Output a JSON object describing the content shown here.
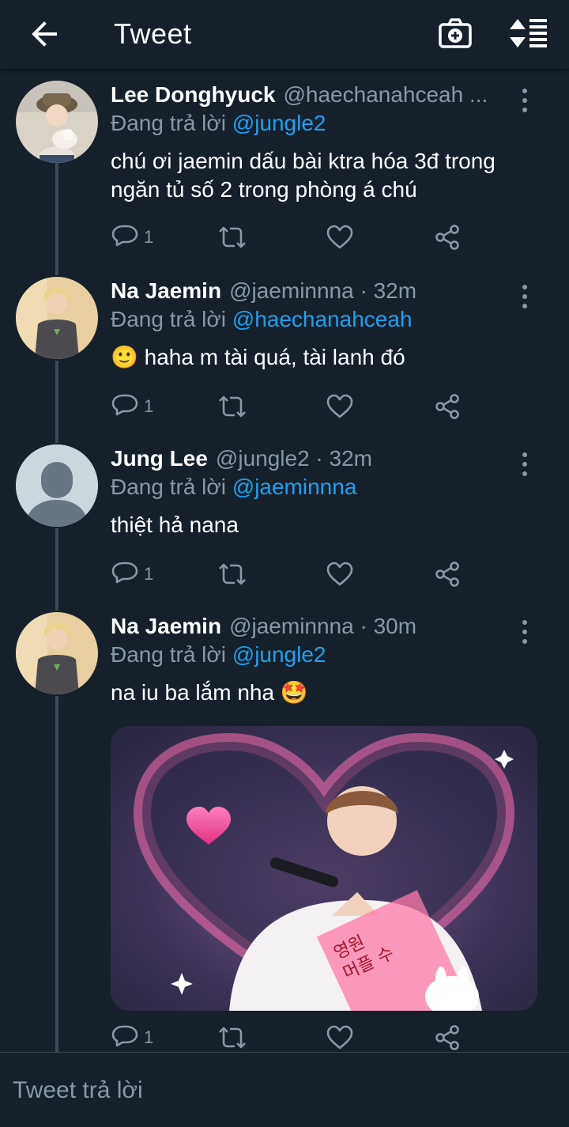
{
  "header": {
    "title": "Tweet",
    "back_icon": "arrow-left-icon",
    "camera_icon": "camera-add-icon",
    "sort_icon": "sort-icon"
  },
  "colors": {
    "background": "#15202b",
    "accent": "#1da1f2",
    "muted": "#8899a6",
    "thread_line": "#3d4b59"
  },
  "tweets": [
    {
      "display_name": "Lee Donghyuck",
      "handle": "@haechanahceah ...",
      "reply_prefix": "Đang trả lời",
      "reply_to": "@jungle2",
      "text": "chú ơi jaemin dấu bài ktra hóa 3đ trong ngăn tủ số 2 trong phòng á chú",
      "reply_count": "1"
    },
    {
      "display_name": "Na Jaemin",
      "handle": "@jaeminnna · 32m",
      "reply_prefix": "Đang trả lời",
      "reply_to": "@haechanahceah",
      "text": "haha m tài quá, tài lanh đó",
      "emoji": "🙂",
      "reply_count": "1"
    },
    {
      "display_name": "Jung Lee",
      "handle": "@jungle2 · 32m",
      "reply_prefix": "Đang trả lời",
      "reply_to": "@jaeminnna",
      "text": "thiệt hả nana",
      "reply_count": "1"
    },
    {
      "display_name": "Na Jaemin",
      "handle": "@jaeminnna · 30m",
      "reply_prefix": "Đang trả lời",
      "reply_to": "@jungle2",
      "text": "na iu ba lắm nha",
      "emoji": "🤩",
      "reply_count": "1",
      "media_korean": [
        "영원",
        "머플 수"
      ]
    }
  ],
  "compose": {
    "placeholder": "Tweet trả lời"
  }
}
